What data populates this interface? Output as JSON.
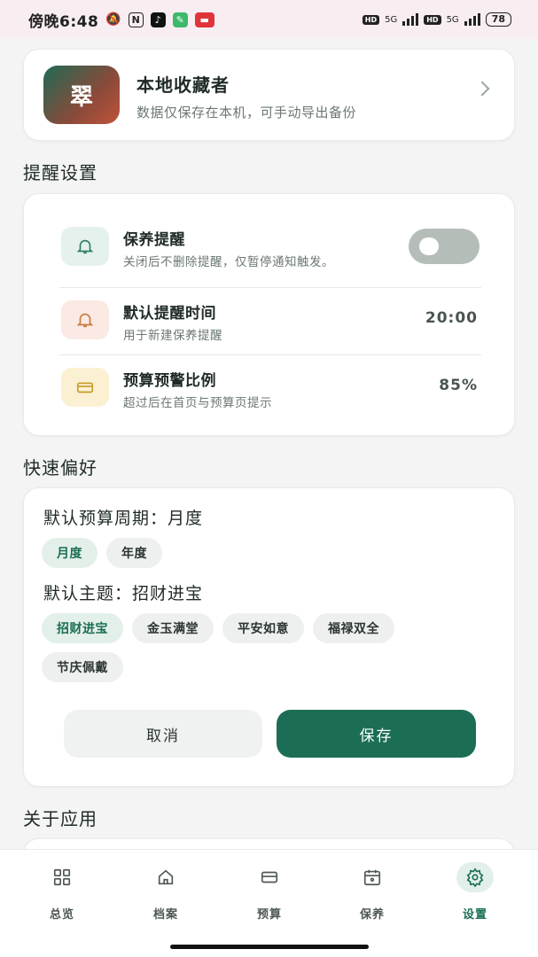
{
  "status_bar": {
    "time": "傍晚6:48",
    "hd_label": "HD",
    "network": "5G",
    "battery": "78"
  },
  "profile": {
    "avatar_text": "翠",
    "name": "本地收藏者",
    "description": "数据仅保存在本机，可手动导出备份"
  },
  "reminder_section": {
    "title": "提醒设置",
    "rows": [
      {
        "title": "保养提醒",
        "subtitle": "关闭后不删除提醒，仅暂停通知触发。",
        "enabled": false
      },
      {
        "title": "默认提醒时间",
        "subtitle": "用于新建保养提醒",
        "value": "20:00"
      },
      {
        "title": "预算预警比例",
        "subtitle": "超过后在首页与预算页提示",
        "value": "85%"
      }
    ]
  },
  "quick_prefs": {
    "title": "快速偏好",
    "budget_period_label": "默认预算周期：月度",
    "budget_period_options": [
      "月度",
      "年度"
    ],
    "selected_period": "月度",
    "theme_label": "默认主题：招财进宝",
    "theme_options": [
      "招财进宝",
      "金玉满堂",
      "平安如意",
      "福禄双全",
      "节庆佩戴"
    ],
    "selected_theme": "招财进宝",
    "cancel_label": "取消",
    "save_label": "保存"
  },
  "about_section": {
    "title": "关于应用"
  },
  "tabbar": {
    "items": [
      {
        "label": "总览",
        "icon": "grid-icon"
      },
      {
        "label": "档案",
        "icon": "home-icon"
      },
      {
        "label": "预算",
        "icon": "card-icon"
      },
      {
        "label": "保养",
        "icon": "calendar-icon"
      },
      {
        "label": "设置",
        "icon": "gear-icon",
        "active": true
      }
    ]
  },
  "colors": {
    "accent": "#1b6e55",
    "accent_soft": "#e3f0ea",
    "toggle_off": "#b5bdb9",
    "bell_bg": "#e5f1ec",
    "bell2_bg": "#fbe9e4",
    "card_icon_bg": "#fbf0d2"
  }
}
